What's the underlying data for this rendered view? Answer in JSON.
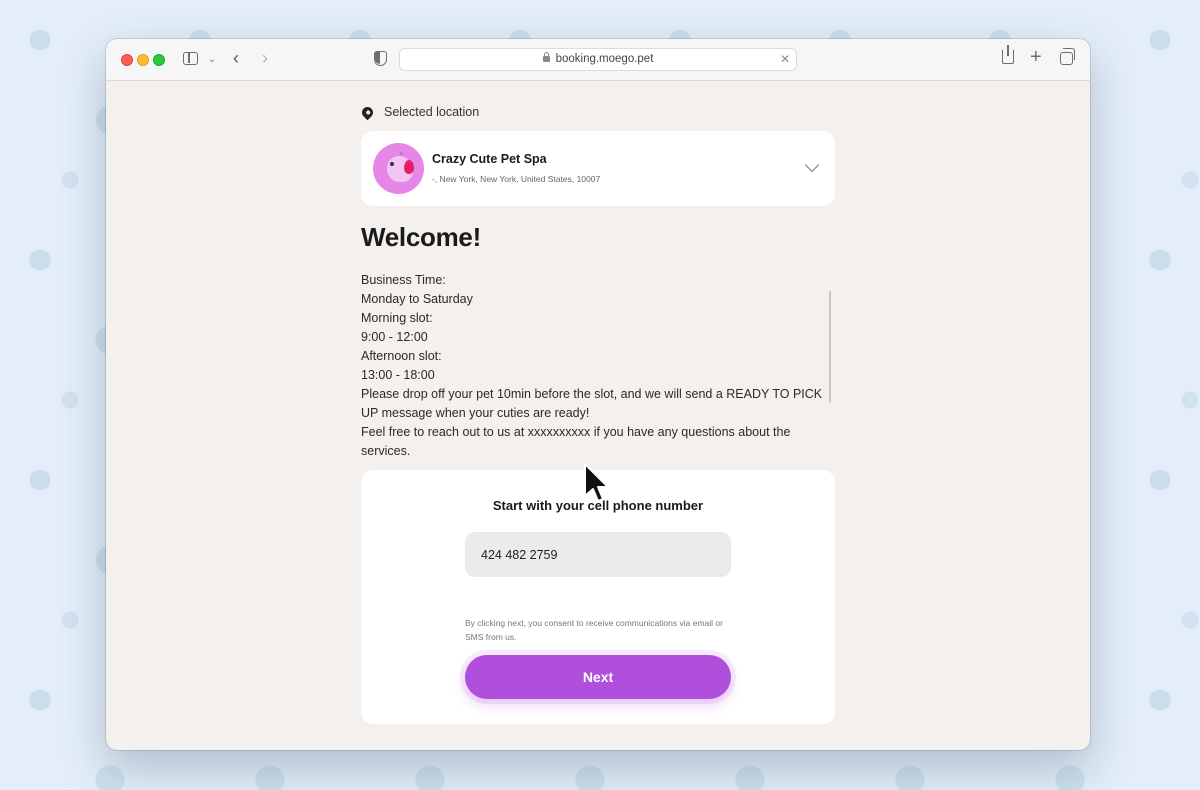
{
  "browser": {
    "url": "booking.moego.pet"
  },
  "location": {
    "label": "Selected location",
    "business_name": "Crazy Cute Pet Spa",
    "address": "-, New York, New York, United States, 10007"
  },
  "welcome": {
    "title": "Welcome!",
    "lines": [
      "Business Time:",
      "Monday to Saturday",
      "Morning slot:",
      "9:00 - 12:00",
      "Afternoon slot:",
      "13:00 - 18:00",
      "Please drop off your pet 10min before the slot, and we will send a READY TO PICK UP message when your cuties are ready!",
      "Feel free to reach out to us at xxxxxxxxxx if you have any questions about the services."
    ]
  },
  "phone_form": {
    "title": "Start with your cell phone number",
    "phone_value": "424 482 2759",
    "consent": "By clicking next, you consent to receive communications via email or SMS from us.",
    "next_label": "Next"
  },
  "colors": {
    "accent": "#b14fdd",
    "page_bg": "#f3f0ed"
  }
}
